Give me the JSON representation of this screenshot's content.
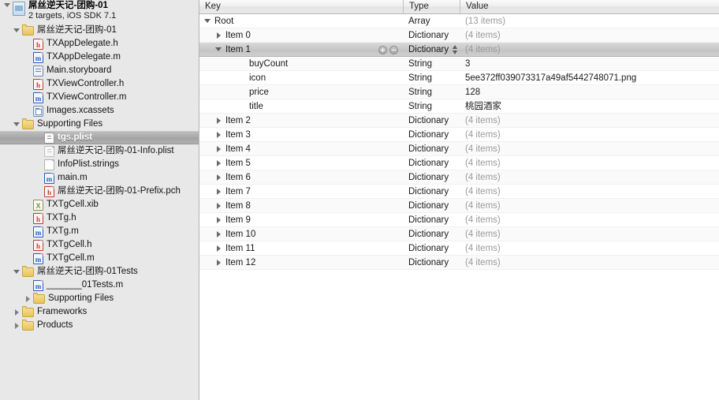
{
  "navigator": {
    "project": {
      "title": "屌丝逆天记-团购-01",
      "subtitle": "2 targets, iOS SDK 7.1"
    },
    "items": [
      {
        "label": "屌丝逆天记-团购-01",
        "icon": "folder-icon",
        "indent": 1,
        "twisty": "open",
        "kind": "folder"
      },
      {
        "label": "TXAppDelegate.h",
        "icon": "header-file-icon",
        "indent": 2,
        "twisty": "blank",
        "kind": "hdr"
      },
      {
        "label": "TXAppDelegate.m",
        "icon": "source-file-icon",
        "indent": 2,
        "twisty": "blank",
        "kind": "impl"
      },
      {
        "label": "Main.storyboard",
        "icon": "storyboard-file-icon",
        "indent": 2,
        "twisty": "blank",
        "kind": "storyboard"
      },
      {
        "label": "TXViewController.h",
        "icon": "header-file-icon",
        "indent": 2,
        "twisty": "blank",
        "kind": "hdr"
      },
      {
        "label": "TXViewController.m",
        "icon": "source-file-icon",
        "indent": 2,
        "twisty": "blank",
        "kind": "impl"
      },
      {
        "label": "Images.xcassets",
        "icon": "asset-catalog-icon",
        "indent": 2,
        "twisty": "blank",
        "kind": "assets"
      },
      {
        "label": "Supporting Files",
        "icon": "folder-icon",
        "indent": 1,
        "twisty": "open",
        "kind": "folder"
      },
      {
        "label": "tgs.plist",
        "icon": "plist-file-icon",
        "indent": 3,
        "twisty": "blank",
        "kind": "plist",
        "selected": true
      },
      {
        "label": "屌丝逆天记-团购-01-Info.plist",
        "icon": "plist-file-icon",
        "indent": 3,
        "twisty": "blank",
        "kind": "plist-dim"
      },
      {
        "label": "InfoPlist.strings",
        "icon": "plain-file-icon",
        "indent": 3,
        "twisty": "blank",
        "kind": "plain"
      },
      {
        "label": "main.m",
        "icon": "source-file-icon",
        "indent": 3,
        "twisty": "blank",
        "kind": "impl"
      },
      {
        "label": "屌丝逆天记-团购-01-Prefix.pch",
        "icon": "header-file-icon",
        "indent": 3,
        "twisty": "blank",
        "kind": "hdr"
      },
      {
        "label": "TXTgCell.xib",
        "icon": "xib-file-icon",
        "indent": 2,
        "twisty": "blank",
        "kind": "xib"
      },
      {
        "label": "TXTg.h",
        "icon": "header-file-icon",
        "indent": 2,
        "twisty": "blank",
        "kind": "hdr"
      },
      {
        "label": "TXTg.m",
        "icon": "source-file-icon",
        "indent": 2,
        "twisty": "blank",
        "kind": "impl"
      },
      {
        "label": "TXTgCell.h",
        "icon": "header-file-icon",
        "indent": 2,
        "twisty": "blank",
        "kind": "hdr"
      },
      {
        "label": "TXTgCell.m",
        "icon": "source-file-icon",
        "indent": 2,
        "twisty": "blank",
        "kind": "impl"
      },
      {
        "label": "屌丝逆天记-团购-01Tests",
        "icon": "folder-icon",
        "indent": 1,
        "twisty": "open",
        "kind": "folder"
      },
      {
        "label": "_______01Tests.m",
        "icon": "source-file-icon",
        "indent": 2,
        "twisty": "blank",
        "kind": "impl"
      },
      {
        "label": "Supporting Files",
        "icon": "folder-icon",
        "indent": 2,
        "twisty": "closed",
        "kind": "folder"
      },
      {
        "label": "Frameworks",
        "icon": "folder-icon",
        "indent": 1,
        "twisty": "closed",
        "kind": "folder"
      },
      {
        "label": "Products",
        "icon": "folder-icon",
        "indent": 1,
        "twisty": "closed",
        "kind": "folder"
      }
    ]
  },
  "editor": {
    "columns": {
      "key": "Key",
      "type": "Type",
      "value": "Value"
    },
    "rows": [
      {
        "key": "Root",
        "type": "Array",
        "value": "(13 items)",
        "indent": 0,
        "twisty": "open",
        "dim": true
      },
      {
        "key": "Item 0",
        "type": "Dictionary",
        "value": "(4 items)",
        "indent": 1,
        "twisty": "closed",
        "dim": true
      },
      {
        "key": "Item 1",
        "type": "Dictionary",
        "value": "(4 items)",
        "indent": 1,
        "twisty": "open",
        "dim": true,
        "selected": true,
        "buttons": true,
        "stepper": true
      },
      {
        "key": "buyCount",
        "type": "String",
        "value": "3",
        "indent": 2,
        "twisty": "none",
        "dim": false
      },
      {
        "key": "icon",
        "type": "String",
        "value": "5ee372ff039073317a49af5442748071.png",
        "indent": 2,
        "twisty": "none",
        "dim": false
      },
      {
        "key": "price",
        "type": "String",
        "value": "128",
        "indent": 2,
        "twisty": "none",
        "dim": false
      },
      {
        "key": "title",
        "type": "String",
        "value": "桃园酒家",
        "indent": 2,
        "twisty": "none",
        "dim": false
      },
      {
        "key": "Item 2",
        "type": "Dictionary",
        "value": "(4 items)",
        "indent": 1,
        "twisty": "closed",
        "dim": true
      },
      {
        "key": "Item 3",
        "type": "Dictionary",
        "value": "(4 items)",
        "indent": 1,
        "twisty": "closed",
        "dim": true
      },
      {
        "key": "Item 4",
        "type": "Dictionary",
        "value": "(4 items)",
        "indent": 1,
        "twisty": "closed",
        "dim": true
      },
      {
        "key": "Item 5",
        "type": "Dictionary",
        "value": "(4 items)",
        "indent": 1,
        "twisty": "closed",
        "dim": true
      },
      {
        "key": "Item 6",
        "type": "Dictionary",
        "value": "(4 items)",
        "indent": 1,
        "twisty": "closed",
        "dim": true
      },
      {
        "key": "Item 7",
        "type": "Dictionary",
        "value": "(4 items)",
        "indent": 1,
        "twisty": "closed",
        "dim": true
      },
      {
        "key": "Item 8",
        "type": "Dictionary",
        "value": "(4 items)",
        "indent": 1,
        "twisty": "closed",
        "dim": true
      },
      {
        "key": "Item 9",
        "type": "Dictionary",
        "value": "(4 items)",
        "indent": 1,
        "twisty": "closed",
        "dim": true
      },
      {
        "key": "Item 10",
        "type": "Dictionary",
        "value": "(4 items)",
        "indent": 1,
        "twisty": "closed",
        "dim": true
      },
      {
        "key": "Item 11",
        "type": "Dictionary",
        "value": "(4 items)",
        "indent": 1,
        "twisty": "closed",
        "dim": true
      },
      {
        "key": "Item 12",
        "type": "Dictionary",
        "value": "(4 items)",
        "indent": 1,
        "twisty": "closed",
        "dim": true
      }
    ]
  },
  "colors": {
    "navigator_background": "#e8e8e8",
    "editor_background": "#ffffff",
    "selection_gray": "#b0b0b0",
    "header_file": "#c23b22",
    "source_file": "#2a5bbf",
    "folder": "#e8c35c",
    "dim_text": "#9a9a9a"
  }
}
